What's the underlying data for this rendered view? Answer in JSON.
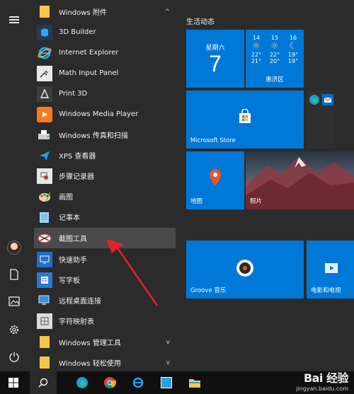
{
  "start_menu": {
    "app_list": [
      {
        "label": "Windows 附件",
        "kind": "folder",
        "chevron": "^",
        "icon": "folder-icon"
      },
      {
        "label": "3D Builder",
        "kind": "app",
        "icon": "3d-builder-icon"
      },
      {
        "label": "Internet Explorer",
        "kind": "app",
        "icon": "internet-explorer-icon"
      },
      {
        "label": "Math Input Panel",
        "kind": "app",
        "icon": "math-input-panel-icon"
      },
      {
        "label": "Print 3D",
        "kind": "app",
        "icon": "print-3d-icon"
      },
      {
        "label": "Windows Media Player",
        "kind": "app",
        "icon": "media-player-icon"
      },
      {
        "label": "Windows 传真和扫描",
        "kind": "app",
        "icon": "fax-scan-icon"
      },
      {
        "label": "XPS 查看器",
        "kind": "app",
        "icon": "xps-viewer-icon"
      },
      {
        "label": "步骤记录器",
        "kind": "app",
        "icon": "steps-recorder-icon"
      },
      {
        "label": "画图",
        "kind": "app",
        "icon": "paint-icon"
      },
      {
        "label": "记事本",
        "kind": "app",
        "icon": "notepad-icon"
      },
      {
        "label": "截图工具",
        "kind": "app",
        "icon": "snipping-tool-icon",
        "selected": true
      },
      {
        "label": "快速助手",
        "kind": "app",
        "icon": "quick-assist-icon"
      },
      {
        "label": "写字板",
        "kind": "app",
        "icon": "wordpad-icon"
      },
      {
        "label": "远程桌面连接",
        "kind": "app",
        "icon": "remote-desktop-icon"
      },
      {
        "label": "字符映射表",
        "kind": "app",
        "icon": "character-map-icon"
      },
      {
        "label": "Windows 管理工具",
        "kind": "folder",
        "chevron": "v",
        "icon": "folder-icon"
      },
      {
        "label": "Windows 轻松使用",
        "kind": "folder",
        "chevron": "v",
        "icon": "folder-icon"
      }
    ],
    "tiles_group_title": "生活动态",
    "calendar_tile": {
      "weekday": "星期六",
      "day": "7"
    },
    "weather_tile": {
      "days": [
        {
          "day": "14",
          "high": "22°",
          "low": "21°"
        },
        {
          "day": "15",
          "high": "22°",
          "low": "20°"
        },
        {
          "day": "16",
          "high": "19°",
          "low": "19°"
        }
      ],
      "location": "惠济区"
    },
    "tiles": {
      "store": "Microsoft Store",
      "maps": "地图",
      "photos": "照片",
      "groove": "Groove 音乐",
      "movies": "电影和电视"
    }
  },
  "watermark": {
    "brand": "Bai 经验",
    "url": "jingyan.baidu.com"
  },
  "colors": {
    "tile_blue": "#0078d7",
    "accent_red": "#e8202a"
  }
}
